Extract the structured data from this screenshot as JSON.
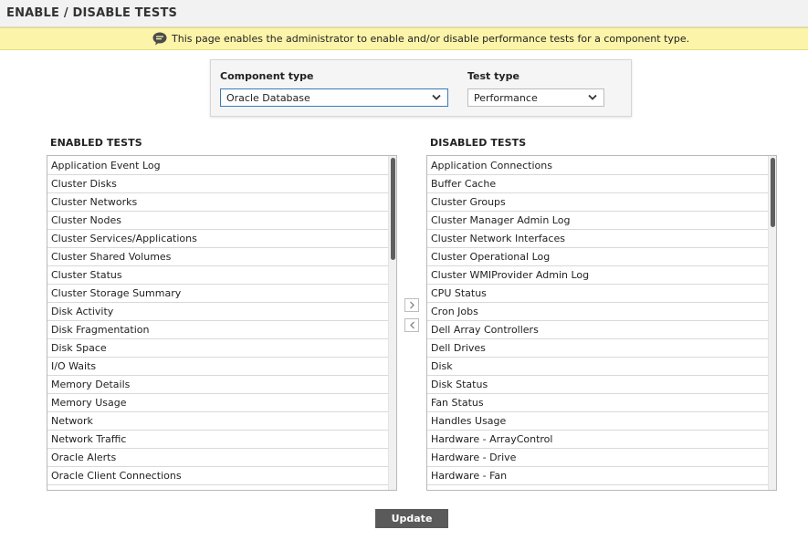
{
  "header": {
    "title": "ENABLE / DISABLE TESTS"
  },
  "info": {
    "icon": "speech-bubble-icon",
    "text": "This page enables the administrator to enable and/or disable performance tests for a component type."
  },
  "selectors": {
    "component_type": {
      "label": "Component type",
      "value": "Oracle Database"
    },
    "test_type": {
      "label": "Test type",
      "value": "Performance"
    }
  },
  "enabled": {
    "title": "ENABLED TESTS",
    "items": [
      "Application Event Log",
      "Cluster Disks",
      "Cluster Networks",
      "Cluster Nodes",
      "Cluster Services/Applications",
      "Cluster Shared Volumes",
      "Cluster Status",
      "Cluster Storage Summary",
      "Disk Activity",
      "Disk Fragmentation",
      "Disk Space",
      "I/O Waits",
      "Memory Details",
      "Memory Usage",
      "Network",
      "Network Traffic",
      "Oracle Alerts",
      "Oracle Client Connections"
    ]
  },
  "disabled": {
    "title": "DISABLED TESTS",
    "items": [
      "Application Connections",
      "Buffer Cache",
      "Cluster Groups",
      "Cluster Manager Admin Log",
      "Cluster Network Interfaces",
      "Cluster Operational Log",
      "Cluster WMIProvider Admin Log",
      "CPU Status",
      "Cron Jobs",
      "Dell Array Controllers",
      "Dell Drives",
      "Disk",
      "Disk Status",
      "Fan Status",
      "Handles Usage",
      "Hardware - ArrayControl",
      "Hardware - Drive",
      "Hardware - Fan"
    ]
  },
  "buttons": {
    "move_right_icon": "chevron-right-icon",
    "move_left_icon": "chevron-left-icon",
    "update_label": "Update"
  },
  "colors": {
    "info_bg": "#fbf4a9",
    "button_bg": "#5a5a5a",
    "focus_border": "#3a7bb8"
  }
}
